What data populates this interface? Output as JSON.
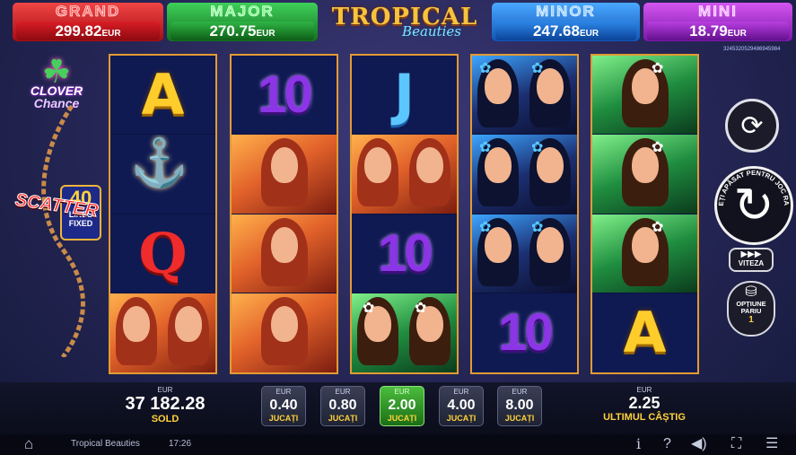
{
  "jackpots": {
    "grand": {
      "title": "GRAND",
      "value": "299.82",
      "currency": "EUR"
    },
    "major": {
      "title": "MAJOR",
      "value": "270.75",
      "currency": "EUR"
    },
    "minor": {
      "title": "MINOR",
      "value": "247.68",
      "currency": "EUR"
    },
    "mini": {
      "title": "MINI",
      "value": "18.79",
      "currency": "EUR"
    }
  },
  "logo": {
    "line1": "TROPICAL",
    "line2": "Beauties"
  },
  "game_id": "3245320529486945984",
  "clover": {
    "line1": "CLOVER",
    "line2": "Chance",
    "icon": "four-leaf-clover-icon"
  },
  "lines": {
    "count": "40",
    "label1": "LINES",
    "label2": "FIXED"
  },
  "reels": {
    "reel1": [
      "A",
      "scatter",
      "Q",
      "redhead-pair"
    ],
    "reel2": [
      "10",
      "redhead",
      "redhead",
      "redhead"
    ],
    "reel3": [
      "J",
      "redhead-pair",
      "10",
      "greenhair-pair"
    ],
    "reel4": [
      "bluehair-pair",
      "bluehair-pair",
      "bluehair-pair",
      "10"
    ],
    "reel5": [
      "greenhair",
      "greenhair",
      "greenhair",
      "A"
    ],
    "symbols": {
      "ace": "A",
      "ten": "10",
      "jack": "J",
      "queen": "Q",
      "scatter": "SCATTER"
    }
  },
  "controls": {
    "autoplay_icon": "autoplay-icon",
    "spin_text": "ȚINEȚI APĂSAT PENTRU JOC RAPID",
    "spin_icon": "spin-icon",
    "speed_label": "VITEZA",
    "bet_option_label1": "OPȚIUNE",
    "bet_option_label2": "PARIU",
    "bet_option_value": "1"
  },
  "balance": {
    "currency": "EUR",
    "value": "37 182.28",
    "label": "SOLD"
  },
  "bets": [
    {
      "currency": "EUR",
      "value": "0.40",
      "label": "JUCAȚI",
      "active": false
    },
    {
      "currency": "EUR",
      "value": "0.80",
      "label": "JUCAȚI",
      "active": false
    },
    {
      "currency": "EUR",
      "value": "2.00",
      "label": "JUCAȚI",
      "active": true
    },
    {
      "currency": "EUR",
      "value": "4.00",
      "label": "JUCAȚI",
      "active": false
    },
    {
      "currency": "EUR",
      "value": "8.00",
      "label": "JUCAȚI",
      "active": false
    }
  ],
  "last_win": {
    "currency": "EUR",
    "value": "2.25",
    "label": "ULTIMUL CÂȘTIG"
  },
  "status_bar": {
    "game_name": "Tropical Beauties",
    "clock": "17:26",
    "icons": [
      "home-icon",
      "info-icon",
      "help-icon",
      "sound-icon",
      "fullscreen-icon",
      "menu-icon"
    ]
  },
  "colors": {
    "accent_yellow": "#ffd23a",
    "reel_frame": "#e29b34",
    "active_bet": "#4bbd3d"
  }
}
